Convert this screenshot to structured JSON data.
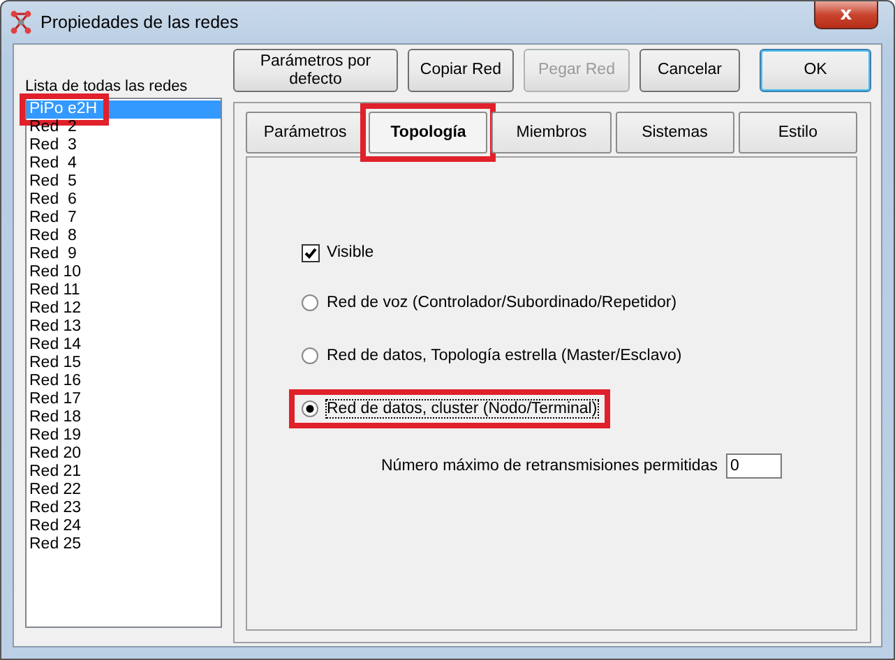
{
  "window": {
    "title": "Propiedades de las redes",
    "close_label": "x"
  },
  "network_list": {
    "label": "Lista de todas las redes",
    "items": [
      {
        "name": "PiPo e2H",
        "selected": true,
        "highlighted": true
      },
      {
        "name": "Red  2",
        "selected": false,
        "highlighted": false
      },
      {
        "name": "Red  3",
        "selected": false,
        "highlighted": false
      },
      {
        "name": "Red  4",
        "selected": false,
        "highlighted": false
      },
      {
        "name": "Red  5",
        "selected": false,
        "highlighted": false
      },
      {
        "name": "Red  6",
        "selected": false,
        "highlighted": false
      },
      {
        "name": "Red  7",
        "selected": false,
        "highlighted": false
      },
      {
        "name": "Red  8",
        "selected": false,
        "highlighted": false
      },
      {
        "name": "Red  9",
        "selected": false,
        "highlighted": false
      },
      {
        "name": "Red 10",
        "selected": false,
        "highlighted": false
      },
      {
        "name": "Red 11",
        "selected": false,
        "highlighted": false
      },
      {
        "name": "Red 12",
        "selected": false,
        "highlighted": false
      },
      {
        "name": "Red 13",
        "selected": false,
        "highlighted": false
      },
      {
        "name": "Red 14",
        "selected": false,
        "highlighted": false
      },
      {
        "name": "Red 15",
        "selected": false,
        "highlighted": false
      },
      {
        "name": "Red 16",
        "selected": false,
        "highlighted": false
      },
      {
        "name": "Red 17",
        "selected": false,
        "highlighted": false
      },
      {
        "name": "Red 18",
        "selected": false,
        "highlighted": false
      },
      {
        "name": "Red 19",
        "selected": false,
        "highlighted": false
      },
      {
        "name": "Red 20",
        "selected": false,
        "highlighted": false
      },
      {
        "name": "Red 21",
        "selected": false,
        "highlighted": false
      },
      {
        "name": "Red 22",
        "selected": false,
        "highlighted": false
      },
      {
        "name": "Red 23",
        "selected": false,
        "highlighted": false
      },
      {
        "name": "Red 24",
        "selected": false,
        "highlighted": false
      },
      {
        "name": "Red 25",
        "selected": false,
        "highlighted": false
      }
    ]
  },
  "buttons": [
    {
      "label": "Parámetros por defecto",
      "disabled": false,
      "default": false
    },
    {
      "label": "Copiar Red",
      "disabled": false,
      "default": false
    },
    {
      "label": "Pegar Red",
      "disabled": true,
      "default": false
    },
    {
      "label": "Cancelar",
      "disabled": false,
      "default": false
    },
    {
      "label": "OK",
      "disabled": false,
      "default": true
    }
  ],
  "tabs": [
    {
      "label": "Parámetros",
      "selected": false,
      "highlighted": false
    },
    {
      "label": "Topología",
      "selected": true,
      "highlighted": true
    },
    {
      "label": "Miembros",
      "selected": false,
      "highlighted": false
    },
    {
      "label": "Sistemas",
      "selected": false,
      "highlighted": false
    },
    {
      "label": "Estilo",
      "selected": false,
      "highlighted": false
    }
  ],
  "topology": {
    "visible": {
      "label": "Visible",
      "checked": true
    },
    "options": [
      {
        "label": "Red de voz (Controlador/Subordinado/Repetidor)",
        "selected": false,
        "highlighted": false
      },
      {
        "label": "Red de datos, Topología estrella (Master/Esclavo)",
        "selected": false,
        "highlighted": false
      },
      {
        "label": "Red de datos, cluster (Nodo/Terminal)",
        "selected": true,
        "highlighted": true
      }
    ],
    "max_retransmissions": {
      "label": "Número máximo de retransmisiones permitidas",
      "value": "0"
    }
  }
}
